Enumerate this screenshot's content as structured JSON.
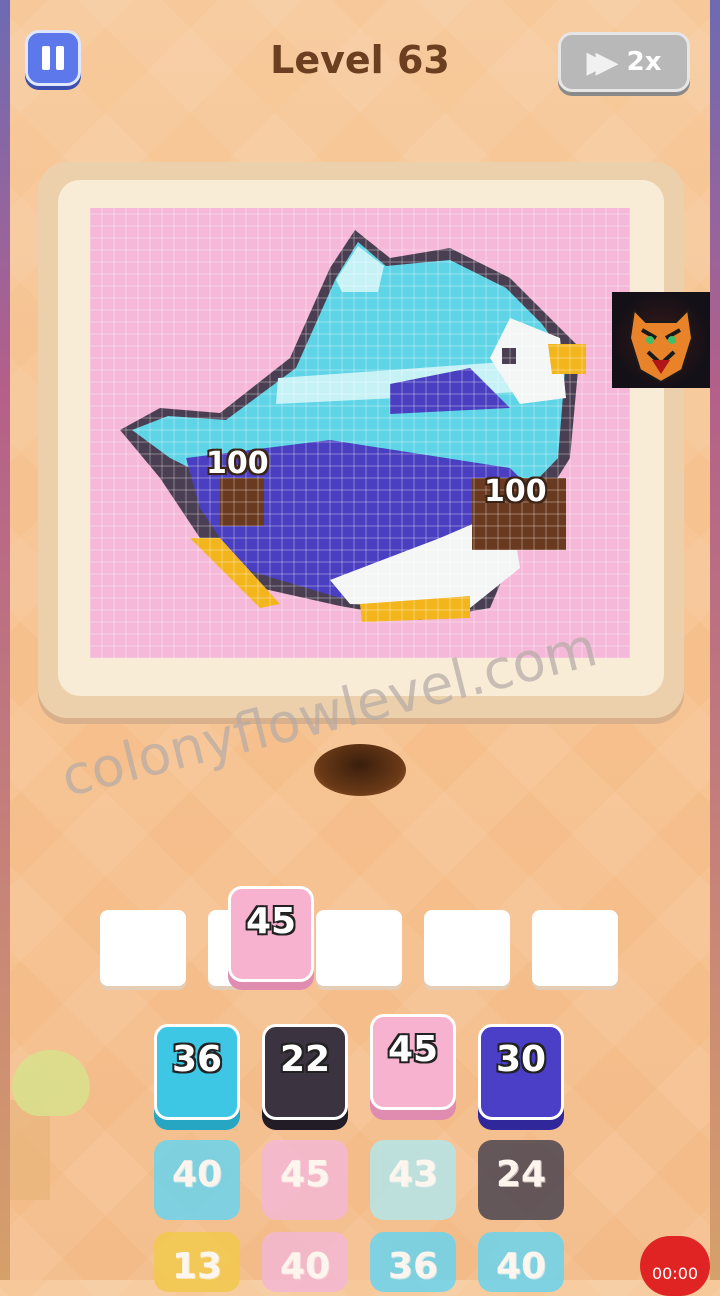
{
  "header": {
    "level_title": "Level 63",
    "speed_label": "2x"
  },
  "board": {
    "chocolate_blocks": [
      {
        "count": "100"
      },
      {
        "count": "100"
      }
    ],
    "colors": {
      "pink": "#f5b8d8",
      "dark": "#4a3f52",
      "cyan": "#5fd4e6",
      "light_cyan": "#c6f2f6",
      "purple": "#4a3fc0",
      "white": "#f4f6f6",
      "yellow": "#f3b51c",
      "chocolate": "#6a3a20"
    }
  },
  "ad_badge": {
    "icon": "tiger-icon"
  },
  "watermark": "colonyflowlevel.com",
  "slots": {
    "held_tile": {
      "value": "45",
      "color": "#f7b2cf"
    }
  },
  "tiles": {
    "row1": [
      {
        "value": "36",
        "color": "#3ec7e4",
        "shade": "#27a6c3"
      },
      {
        "value": "22",
        "color": "#3b3340",
        "shade": "#211c25"
      },
      {
        "value": "45",
        "color": "#f7b2cf",
        "shade": "#e08bb0"
      },
      {
        "value": "30",
        "color": "#4a3fc6",
        "shade": "#2f279a"
      }
    ],
    "row2": [
      {
        "value": "40",
        "color": "#6bd4ee"
      },
      {
        "value": "45",
        "color": "#f4b8d4"
      },
      {
        "value": "43",
        "color": "#b4e6ea"
      },
      {
        "value": "24",
        "color": "#4c4550"
      }
    ],
    "row3": [
      {
        "value": "13",
        "color": "#f2c94c"
      },
      {
        "value": "40",
        "color": "#f4b8d4"
      },
      {
        "value": "36",
        "color": "#6bd4ee"
      },
      {
        "value": "40",
        "color": "#6bd4ee"
      }
    ]
  },
  "timer": "00:00"
}
